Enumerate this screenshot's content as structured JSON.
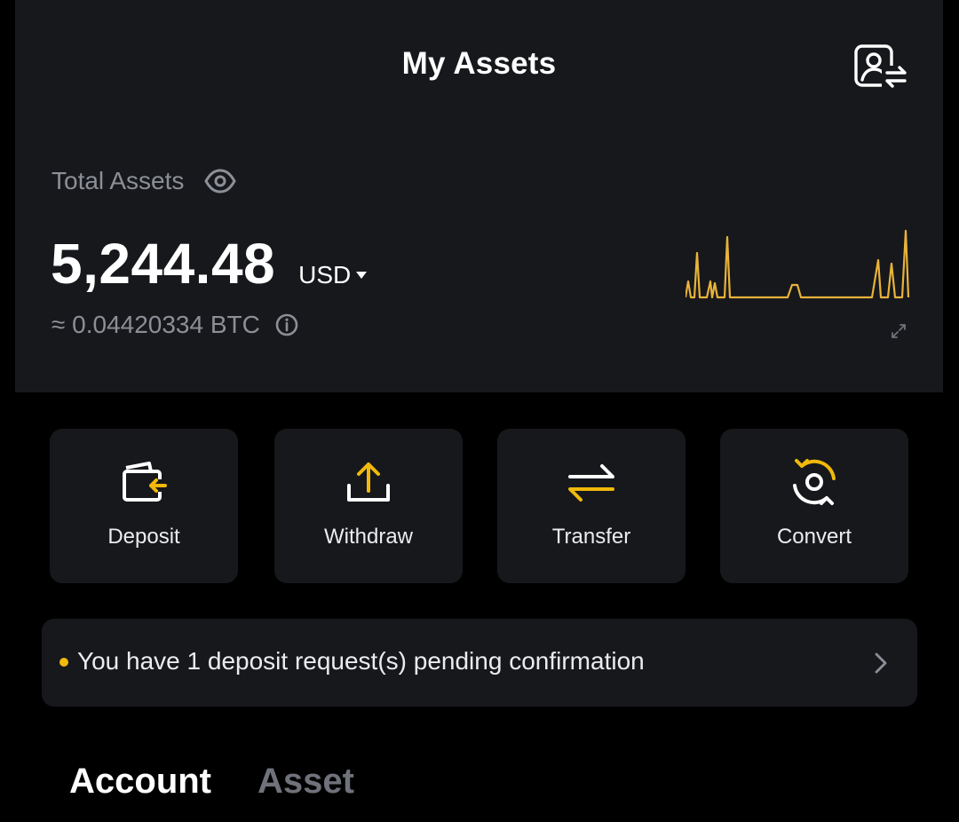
{
  "header": {
    "title": "My Assets",
    "account_icon": "account-switch-icon"
  },
  "summary": {
    "label": "Total Assets",
    "eye_icon": "eye-icon",
    "amount": "5,244.48",
    "currency": "USD",
    "btc_equiv": "≈ 0.04420334 BTC",
    "info_icon": "info-icon"
  },
  "colors": {
    "accent": "#F0B90B",
    "panel": "#17181C",
    "background": "#000000",
    "muted_text": "#8C8F96"
  },
  "actions": [
    {
      "label": "Deposit",
      "icon": "deposit-icon"
    },
    {
      "label": "Withdraw",
      "icon": "withdraw-icon"
    },
    {
      "label": "Transfer",
      "icon": "transfer-icon"
    },
    {
      "label": "Convert",
      "icon": "convert-icon"
    }
  ],
  "notice": {
    "text": "You have 1 deposit request(s) pending confirmation",
    "icon": "chevron-right-icon"
  },
  "tabs": [
    {
      "label": "Account",
      "active": true
    },
    {
      "label": "Asset",
      "active": false
    }
  ]
}
